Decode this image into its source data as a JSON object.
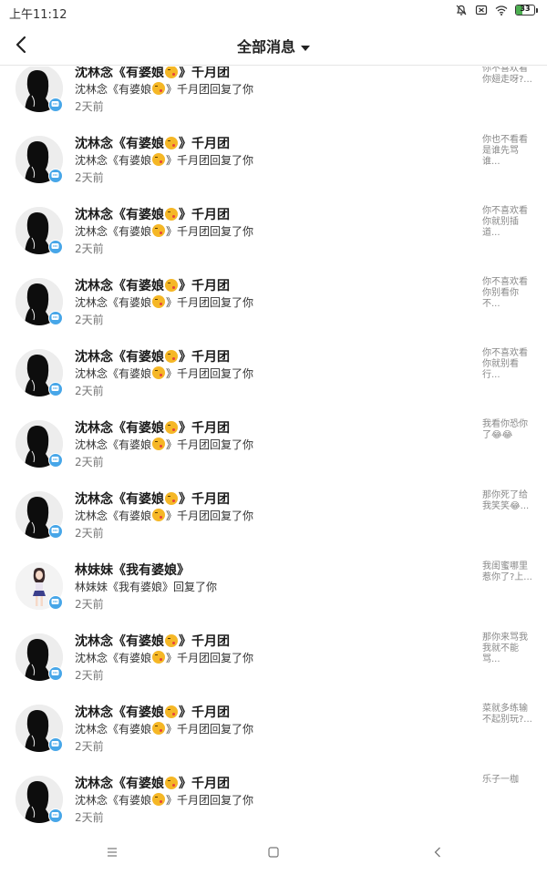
{
  "status_bar": {
    "time": "上午11:12",
    "icons": [
      "mute-bell-icon",
      "sim-x-icon",
      "wifi-icon",
      "battery-icon"
    ],
    "battery_level": "33",
    "battery_color": "#4caf50"
  },
  "header": {
    "back_icon": "chevron-left-icon",
    "title": "全部消息",
    "dropdown_icon": "caret-down-icon"
  },
  "messages": [
    {
      "name_a": "沈林念《有婆娘",
      "emoji": "kissing-face",
      "name_b": "》千月团",
      "desc_a": "沈林念《有婆娘",
      "desc_b": "》千月团回复了你",
      "time": "2天前",
      "preview": "你不喜欢看你翅走呀?...",
      "avatar": "silhouette"
    },
    {
      "name_a": "沈林念《有婆娘",
      "emoji": "kissing-face",
      "name_b": "》千月团",
      "desc_a": "沈林念《有婆娘",
      "desc_b": "》千月团回复了你",
      "time": "2天前",
      "preview": "你也不看看是谁先骂谁...",
      "avatar": "silhouette"
    },
    {
      "name_a": "沈林念《有婆娘",
      "emoji": "kissing-face",
      "name_b": "》千月团",
      "desc_a": "沈林念《有婆娘",
      "desc_b": "》千月团回复了你",
      "time": "2天前",
      "preview": "你不喜欢看你就别插道...",
      "avatar": "silhouette"
    },
    {
      "name_a": "沈林念《有婆娘",
      "emoji": "kissing-face",
      "name_b": "》千月团",
      "desc_a": "沈林念《有婆娘",
      "desc_b": "》千月团回复了你",
      "time": "2天前",
      "preview": "你不喜欢看你别看你不...",
      "avatar": "silhouette"
    },
    {
      "name_a": "沈林念《有婆娘",
      "emoji": "kissing-face",
      "name_b": "》千月团",
      "desc_a": "沈林念《有婆娘",
      "desc_b": "》千月团回复了你",
      "time": "2天前",
      "preview": "你不喜欢看你就别看行...",
      "avatar": "silhouette"
    },
    {
      "name_a": "沈林念《有婆娘",
      "emoji": "kissing-face",
      "name_b": "》千月团",
      "desc_a": "沈林念《有婆娘",
      "desc_b": "》千月团回复了你",
      "time": "2天前",
      "preview": "我看你恐你了😂😂",
      "avatar": "silhouette"
    },
    {
      "name_a": "沈林念《有婆娘",
      "emoji": "kissing-face",
      "name_b": "》千月团",
      "desc_a": "沈林念《有婆娘",
      "desc_b": "》千月团回复了你",
      "time": "2天前",
      "preview": "那你死了给我笑笑😂...",
      "avatar": "silhouette"
    },
    {
      "name_a": "林妹妹《我有婆娘》",
      "emoji": "",
      "name_b": "",
      "desc_a": "林妹妹《我有婆娘》回复了你",
      "desc_b": "",
      "time": "2天前",
      "preview": "我闺蜜哪里惹你了?上...",
      "avatar": "anime-girl"
    },
    {
      "name_a": "沈林念《有婆娘",
      "emoji": "kissing-face",
      "name_b": "》千月团",
      "desc_a": "沈林念《有婆娘",
      "desc_b": "》千月团回复了你",
      "time": "2天前",
      "preview": "那你来骂我我就不能骂...",
      "avatar": "silhouette"
    },
    {
      "name_a": "沈林念《有婆娘",
      "emoji": "kissing-face",
      "name_b": "》千月团",
      "desc_a": "沈林念《有婆娘",
      "desc_b": "》千月团回复了你",
      "time": "2天前",
      "preview": "菜就多练输不起别玩?...",
      "avatar": "silhouette"
    },
    {
      "name_a": "沈林念《有婆娘",
      "emoji": "kissing-face",
      "name_b": "》千月团",
      "desc_a": "沈林念《有婆娘",
      "desc_b": "》千月团回复了你",
      "time": "2天前",
      "preview": "乐子一枷",
      "avatar": "silhouette"
    }
  ],
  "nav_bar": {
    "icons": [
      "menu-icon",
      "home-square-icon",
      "back-triangle-icon"
    ]
  },
  "colors": {
    "badge": "#47a6e8",
    "emoji_face": "#f5b726",
    "divider": "#e6e6e6"
  }
}
